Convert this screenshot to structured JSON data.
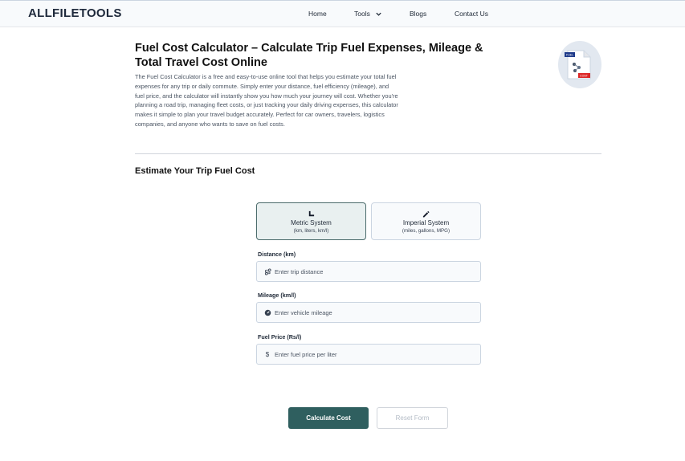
{
  "header": {
    "logo": "ALLFILETOOLS",
    "nav": {
      "home": "Home",
      "tools": "Tools",
      "blogs": "Blogs",
      "contact": "Contact Us"
    }
  },
  "hero": {
    "title": "Fuel Cost Calculator – Calculate Trip Fuel Expenses, Mileage & Total Travel Cost Online",
    "description": "The Fuel Cost Calculator is a free and easy-to-use online tool that helps you estimate your total fuel expenses for any trip or daily commute. Simply enter your distance, fuel efficiency (mileage), and fuel price, and the calculator will instantly show you how much your journey will cost. Whether you're planning a road trip, managing fleet costs, or just tracking your daily driving expenses, this calculator makes it simple to plan your travel budget accurately. Perfect for car owners, travelers, logistics companies, and anyone who wants to save on fuel costs.",
    "icon_badge_top": "FUEL",
    "icon_badge_bottom": "COST"
  },
  "calculator": {
    "section_title": "Estimate Your Trip Fuel Cost",
    "systems": {
      "metric": {
        "label": "Metric System",
        "sub": "(km, liters, km/l)",
        "icon": "ruler-icon"
      },
      "imperial": {
        "label": "Imperial System",
        "sub": "(miles, gallons, MPG)",
        "icon": "pencil-ruler-icon"
      }
    },
    "fields": {
      "distance": {
        "label": "Distance (km)",
        "placeholder": "Enter trip distance",
        "icon": "route-icon"
      },
      "mileage": {
        "label": "Mileage (km/l)",
        "placeholder": "Enter vehicle mileage",
        "icon": "gauge-icon"
      },
      "price": {
        "label": "Fuel Price (Rs/l)",
        "placeholder": "Enter fuel price per liter",
        "icon": "dollar-icon",
        "symbol": "$"
      }
    },
    "buttons": {
      "calculate": "Calculate Cost",
      "reset": "Reset Form"
    }
  },
  "colors": {
    "accent": "#2f5f5f",
    "selected_bg": "#e9f0f0",
    "field_bg": "#f8fafc"
  }
}
